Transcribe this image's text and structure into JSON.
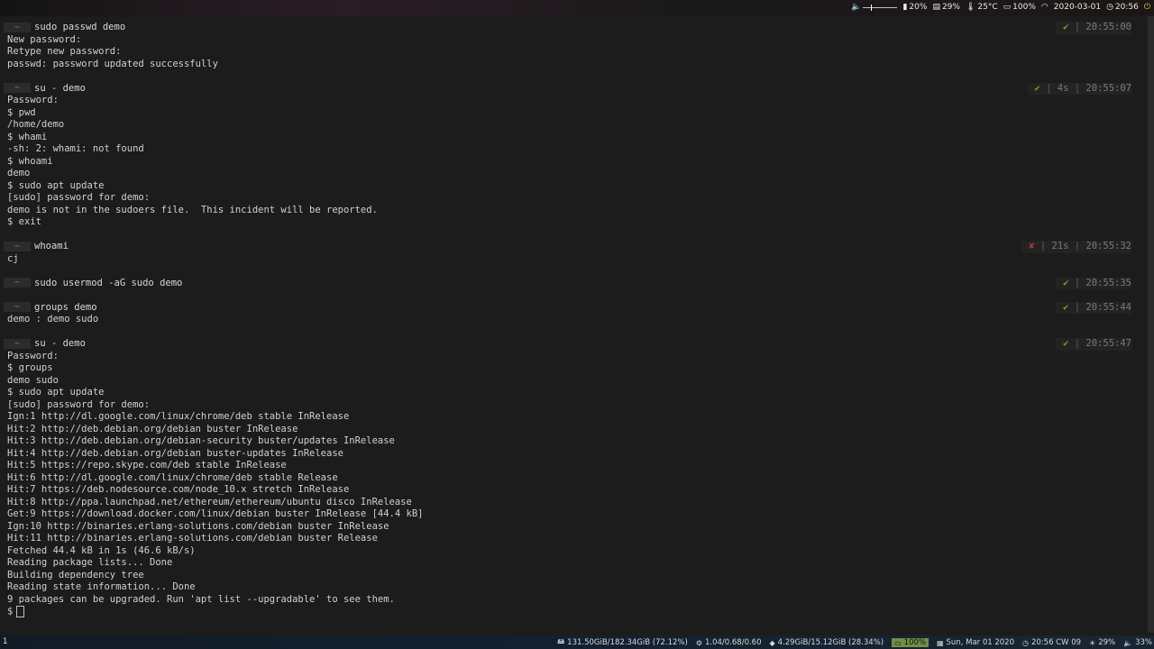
{
  "topbar": {
    "volume_icon": "speaker-icon",
    "brightness": "20%",
    "memory": "29%",
    "temperature": "25°C",
    "battery": "100%",
    "date": "2020-03-01",
    "time": "20:56"
  },
  "terminal": {
    "blocks": [
      {
        "cmd": "sudo passwd demo",
        "status": "ok",
        "duration": "",
        "time": "20:55:00",
        "output": [
          "New password:",
          "Retype new password:",
          "passwd: password updated successfully"
        ]
      },
      {
        "cmd": "su - demo",
        "status": "ok",
        "duration": "4s",
        "time": "20:55:07",
        "output": [
          "Password:",
          "$ pwd",
          "/home/demo",
          "$ whami",
          "-sh: 2: whami: not found",
          "$ whoami",
          "demo",
          "$ sudo apt update",
          "[sudo] password for demo:",
          "demo is not in the sudoers file.  This incident will be reported.",
          "$ exit"
        ]
      },
      {
        "cmd": "whoami",
        "status": "fail",
        "duration": "21s",
        "time": "20:55:32",
        "output": [
          "cj"
        ]
      },
      {
        "cmd": "sudo usermod -aG sudo demo",
        "status": "ok",
        "duration": "",
        "time": "20:55:35",
        "output": []
      },
      {
        "cmd": "groups demo",
        "status": "ok",
        "duration": "",
        "time": "20:55:44",
        "output": [
          "demo : demo sudo"
        ]
      },
      {
        "cmd": "su - demo",
        "status": "ok",
        "duration": "",
        "time": "20:55:47",
        "output": [
          "Password:",
          "$ groups",
          "demo sudo",
          "$ sudo apt update",
          "[sudo] password for demo:",
          "Ign:1 http://dl.google.com/linux/chrome/deb stable InRelease",
          "Hit:2 http://deb.debian.org/debian buster InRelease",
          "Hit:3 http://deb.debian.org/debian-security buster/updates InRelease",
          "Hit:4 http://deb.debian.org/debian buster-updates InRelease",
          "Hit:5 https://repo.skype.com/deb stable InRelease",
          "Hit:6 http://dl.google.com/linux/chrome/deb stable Release",
          "Hit:7 https://deb.nodesource.com/node_10.x stretch InRelease",
          "Hit:8 http://ppa.launchpad.net/ethereum/ethereum/ubuntu disco InRelease",
          "Get:9 https://download.docker.com/linux/debian buster InRelease [44.4 kB]",
          "Ign:10 http://binaries.erlang-solutions.com/debian buster InRelease",
          "Hit:11 http://binaries.erlang-solutions.com/debian buster Release",
          "Fetched 44.4 kB in 1s (46.6 kB/s)",
          "Reading package lists... Done",
          "Building dependency tree",
          "Reading state information... Done",
          "9 packages can be upgraded. Run 'apt list --upgradable' to see them."
        ]
      }
    ],
    "final_prompt": "$",
    "home_symbol": "~",
    "check_mark": "✔",
    "fail_mark": "✘"
  },
  "bottombar": {
    "workspace": "1",
    "disk": "131.50GiB/182.34GiB (72.12%)",
    "load": "1.04/0.68/0.60",
    "mem": "4.29GiB/15.12GiB (28.34%)",
    "battery": "100%",
    "date": "Sun, Mar 01 2020",
    "clock": "20:56 CW 09",
    "brightness": "29%",
    "volume": "33%"
  }
}
